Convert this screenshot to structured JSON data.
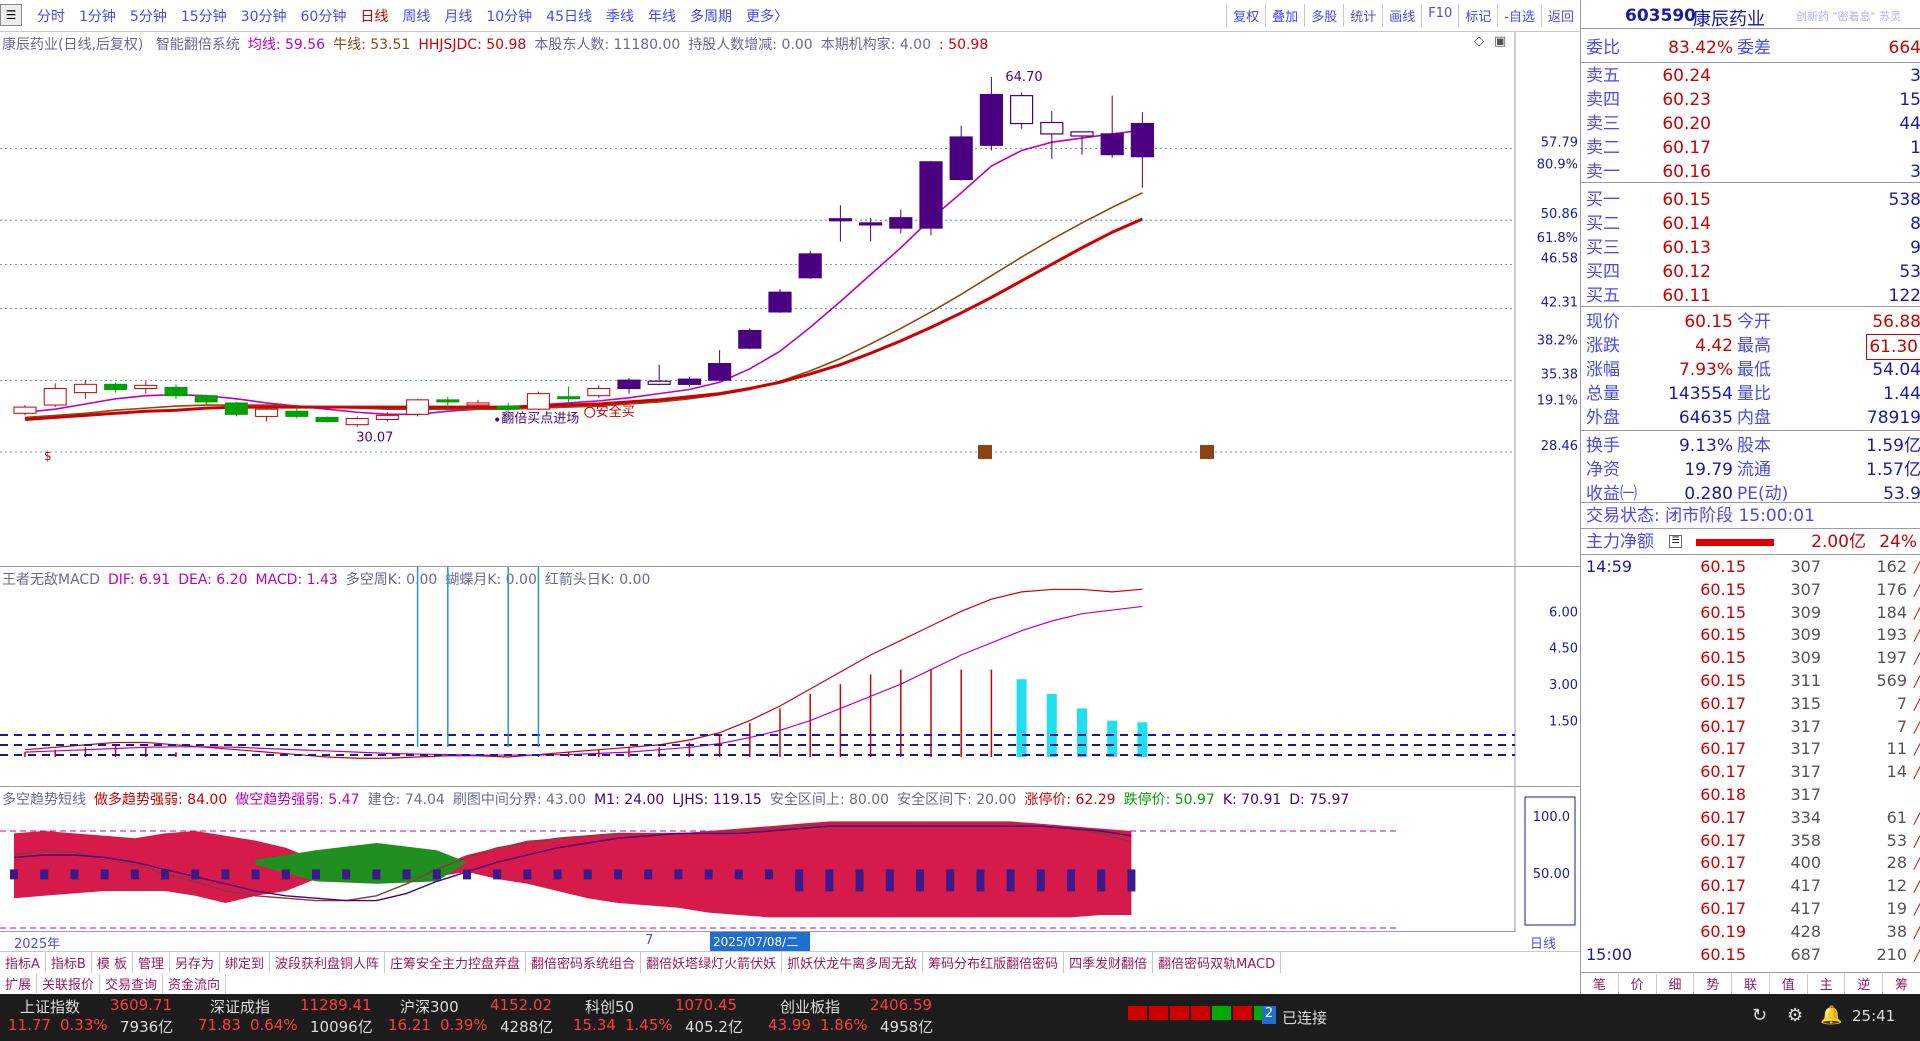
{
  "toolbar": {
    "periods": [
      "分时",
      "1分钟",
      "5分钟",
      "15分钟",
      "30分钟",
      "60分钟",
      "日线",
      "周线",
      "月线",
      "10分钟",
      "45日线",
      "季线",
      "年线",
      "多周期",
      "更多〉"
    ],
    "active_period": "日线",
    "tools": [
      "复权",
      "叠加",
      "多股",
      "统计",
      "画线",
      "F10",
      "标记",
      "-自选",
      "返回"
    ]
  },
  "main_chart": {
    "header": "康辰药业(日线,后复权)",
    "indicators": [
      {
        "label": "智能翻倍系统",
        "color": "#6a6a9a"
      },
      {
        "label": "均线: 59.56",
        "color": "#c000c0"
      },
      {
        "label": "牛线: 53.51",
        "color": "#8a4a10"
      },
      {
        "label": "HHJSJDC: 50.98",
        "color": "#d00000"
      },
      {
        "label": "本股东人数: 11180.00",
        "color": "#6a6a9a"
      },
      {
        "label": "持股人数增减: 0.00",
        "color": "#6a6a9a"
      },
      {
        "label": "本期机构家: 4.00",
        "color": "#6a6a9a"
      },
      {
        "label": ": 50.98",
        "color": "#d00000"
      }
    ],
    "price_labels": [
      "57.79",
      "50.86",
      "46.58",
      "42.31",
      "35.38",
      "28.46"
    ],
    "pct_labels": [
      "80.9%",
      "61.8%",
      "38.2%",
      "19.1%"
    ],
    "annotations": {
      "high": "64.70",
      "low": "30.07",
      "buy_signal": "翻倍买点进场",
      "safe_buy": "安全买"
    }
  },
  "macd_chart": {
    "header": [
      "王者无敌MACD",
      "DIF: 6.91",
      "DEA: 6.20",
      "MACD: 1.43",
      "多空周K: 0.00",
      "蝴蝶月K: 0.00",
      "红箭头日K: 0.00"
    ],
    "axis_labels": [
      "6.00",
      "4.50",
      "3.00",
      "1.50"
    ]
  },
  "ind_chart": {
    "header": [
      "多空趋势短线",
      "做多趋势强弱: 84.00",
      "做空趋势强弱: 5.47",
      "建仓: 74.04",
      "刷图中间分界: 43.00",
      "M1: 24.00",
      "LJHS: 119.15",
      "安全区间上: 80.00",
      "安全区间下: 20.00",
      "涨停价: 62.29",
      "跌停价: 50.97",
      "K: 70.91",
      "D: 75.97"
    ],
    "axis_labels": [
      "100.0",
      "50.00"
    ]
  },
  "datebar": {
    "year": "2025年",
    "mark": "7",
    "selected": "2025/07/08/二",
    "period": "日线"
  },
  "bottom_tabs": [
    "指标A",
    "指标B",
    "模 板",
    "管理",
    "另存为",
    "绑定到",
    "波段获利盘铜人阵",
    "庄筹安全主力控盘弃盘",
    "翻倍密码系统组合",
    "翻倍妖塔绿灯火箭伏妖",
    "抓妖伏龙牛离多周无敌",
    "筹码分布红版翻倍密码",
    "四季发财翻倍",
    "翻倍密码双轨MACD"
  ],
  "bottom_tabs2": [
    "扩展",
    "关联报价",
    "交易查询",
    "资金流向"
  ],
  "right_panel": {
    "code": "603590",
    "name": "康辰药业",
    "tag": "创新药 \"密着息\" 苏灵",
    "weibi": {
      "label": "委比",
      "value": "83.42%",
      "label2": "委差",
      "value2": "664"
    },
    "asks": [
      {
        "label": "卖五",
        "price": "60.24",
        "vol": "3"
      },
      {
        "label": "卖四",
        "price": "60.23",
        "vol": "15"
      },
      {
        "label": "卖三",
        "price": "60.20",
        "vol": "44"
      },
      {
        "label": "卖二",
        "price": "60.17",
        "vol": "1"
      },
      {
        "label": "卖一",
        "price": "60.16",
        "vol": "3"
      }
    ],
    "bids": [
      {
        "label": "买一",
        "price": "60.15",
        "vol": "538"
      },
      {
        "label": "买二",
        "price": "60.14",
        "vol": "8"
      },
      {
        "label": "买三",
        "price": "60.13",
        "vol": "9"
      },
      {
        "label": "买四",
        "price": "60.12",
        "vol": "53"
      },
      {
        "label": "买五",
        "price": "60.11",
        "vol": "122"
      }
    ],
    "quote": [
      {
        "l1": "现价",
        "v1": "60.15",
        "l2": "今开",
        "v2": "56.88"
      },
      {
        "l1": "涨跌",
        "v1": "4.42",
        "l2": "最高",
        "v2": "61.30"
      },
      {
        "l1": "涨幅",
        "v1": "7.93%",
        "l2": "最低",
        "v2": "54.04"
      },
      {
        "l1": "总量",
        "v1": "143554",
        "l2": "量比",
        "v2": "1.44"
      },
      {
        "l1": "外盘",
        "v1": "64635",
        "l2": "内盘",
        "v2": "78919"
      }
    ],
    "fundamentals": [
      {
        "l1": "换手",
        "v1": "9.13%",
        "l2": "股本",
        "v2": "1.59亿"
      },
      {
        "l1": "净资",
        "v1": "19.79",
        "l2": "流通",
        "v2": "1.57亿"
      },
      {
        "l1": "收益㈠",
        "v1": "0.280",
        "l2": "PE(动)",
        "v2": "53.9"
      }
    ],
    "trade_status": "交易状态: 闭市阶段 15:00:01",
    "main_net": {
      "label": "主力净额",
      "value": "2.00亿",
      "pct": "24%"
    },
    "ticks": [
      {
        "t": "14:59",
        "p": "60.15",
        "n": "307",
        "v": "162"
      },
      {
        "t": "",
        "p": "60.15",
        "n": "307",
        "v": "176"
      },
      {
        "t": "",
        "p": "60.15",
        "n": "309",
        "v": "184"
      },
      {
        "t": "",
        "p": "60.15",
        "n": "309",
        "v": "193"
      },
      {
        "t": "",
        "p": "60.15",
        "n": "309",
        "v": "197"
      },
      {
        "t": "",
        "p": "60.15",
        "n": "311",
        "v": "569"
      },
      {
        "t": "",
        "p": "60.17",
        "n": "315",
        "v": "7"
      },
      {
        "t": "",
        "p": "60.17",
        "n": "317",
        "v": "7"
      },
      {
        "t": "",
        "p": "60.17",
        "n": "317",
        "v": "11"
      },
      {
        "t": "",
        "p": "60.17",
        "n": "317",
        "v": "14"
      },
      {
        "t": "",
        "p": "60.18",
        "n": "317",
        "v": ""
      },
      {
        "t": "",
        "p": "60.17",
        "n": "334",
        "v": "61"
      },
      {
        "t": "",
        "p": "60.17",
        "n": "358",
        "v": "53"
      },
      {
        "t": "",
        "p": "60.17",
        "n": "400",
        "v": "28"
      },
      {
        "t": "",
        "p": "60.17",
        "n": "417",
        "v": "12"
      },
      {
        "t": "",
        "p": "60.17",
        "n": "417",
        "v": "19"
      },
      {
        "t": "",
        "p": "60.19",
        "n": "428",
        "v": "38"
      },
      {
        "t": "15:00",
        "p": "60.15",
        "n": "687",
        "v": "210"
      }
    ],
    "bottom_tabs": [
      "笔",
      "价",
      "细",
      "势",
      "联",
      "值",
      "主",
      "逆",
      "筹"
    ]
  },
  "status_bar": {
    "indices": [
      {
        "name": "上证指数",
        "value": "3609.71",
        "chg": "11.77",
        "pct": "0.33%",
        "amt": "7936亿"
      },
      {
        "name": "深证成指",
        "value": "11289.41",
        "chg": "71.83",
        "pct": "0.64%",
        "amt": "10096亿"
      },
      {
        "name": "沪深300",
        "value": "4152.02",
        "chg": "16.21",
        "pct": "0.39%",
        "amt": "4288亿"
      },
      {
        "name": "科创50",
        "value": "1070.45",
        "chg": "15.34",
        "pct": "1.45%",
        "amt": "405.2亿"
      },
      {
        "name": "创业板指",
        "value": "2406.59",
        "chg": "43.99",
        "pct": "1.86%",
        "amt": "4958亿"
      }
    ],
    "connection": "已连接",
    "connection_num": "2",
    "time": "25:41"
  },
  "chart_data": {
    "type": "candlestick",
    "title": "康辰药业(日线,后复权)",
    "ylim": [
      28.46,
      64.7
    ],
    "candles": [
      {
        "o": 32.2,
        "c": 32.8,
        "h": 33.0,
        "l": 32.0
      },
      {
        "o": 33.0,
        "c": 34.6,
        "h": 35.1,
        "l": 32.8
      },
      {
        "o": 34.2,
        "c": 35.0,
        "h": 35.4,
        "l": 33.6
      },
      {
        "o": 35.0,
        "c": 34.5,
        "h": 35.2,
        "l": 34.2
      },
      {
        "o": 34.6,
        "c": 34.9,
        "h": 35.3,
        "l": 34.1
      },
      {
        "o": 34.7,
        "c": 33.9,
        "h": 35.0,
        "l": 33.6
      },
      {
        "o": 33.9,
        "c": 33.3,
        "h": 34.0,
        "l": 33.0
      },
      {
        "o": 33.2,
        "c": 32.1,
        "h": 33.3,
        "l": 31.9
      },
      {
        "o": 31.9,
        "c": 32.6,
        "h": 32.7,
        "l": 31.4
      },
      {
        "o": 32.4,
        "c": 31.9,
        "h": 32.8,
        "l": 31.7
      },
      {
        "o": 31.8,
        "c": 31.4,
        "h": 31.9,
        "l": 31.3
      },
      {
        "o": 31.1,
        "c": 31.7,
        "h": 31.9,
        "l": 30.9
      },
      {
        "o": 31.6,
        "c": 32.0,
        "h": 32.3,
        "l": 31.4
      },
      {
        "o": 32.1,
        "c": 33.5,
        "h": 33.6,
        "l": 31.9
      },
      {
        "o": 33.5,
        "c": 33.3,
        "h": 33.8,
        "l": 32.6
      },
      {
        "o": 33.1,
        "c": 33.2,
        "h": 33.5,
        "l": 32.9
      },
      {
        "o": 32.9,
        "c": 32.6,
        "h": 33.2,
        "l": 31.7
      },
      {
        "o": 32.6,
        "c": 34.1,
        "h": 34.3,
        "l": 32.5
      },
      {
        "o": 33.8,
        "c": 33.7,
        "h": 34.8,
        "l": 33.0
      },
      {
        "o": 33.9,
        "c": 34.6,
        "h": 34.9,
        "l": 33.7
      },
      {
        "o": 34.6,
        "c": 35.4,
        "h": 35.6,
        "l": 34.1
      },
      {
        "o": 35.3,
        "c": 35.0,
        "h": 36.9,
        "l": 34.9
      },
      {
        "o": 35.0,
        "c": 35.5,
        "h": 35.7,
        "l": 34.8
      },
      {
        "o": 35.4,
        "c": 37.0,
        "h": 38.3,
        "l": 35.3
      },
      {
        "o": 38.5,
        "c": 40.2,
        "h": 40.4,
        "l": 38.4
      },
      {
        "o": 42.0,
        "c": 43.9,
        "h": 44.2,
        "l": 41.9
      },
      {
        "o": 45.3,
        "c": 47.6,
        "h": 47.9,
        "l": 45.2
      },
      {
        "o": 51.0,
        "c": 51.0,
        "h": 52.3,
        "l": 48.8
      },
      {
        "o": 50.6,
        "c": 50.6,
        "h": 51.1,
        "l": 48.8
      },
      {
        "o": 50.1,
        "c": 51.1,
        "h": 51.9,
        "l": 49.6
      },
      {
        "o": 50.1,
        "c": 56.5,
        "h": 56.6,
        "l": 49.4
      },
      {
        "o": 54.8,
        "c": 58.9,
        "h": 60.0,
        "l": 54.7
      },
      {
        "o": 58.1,
        "c": 63.0,
        "h": 64.7,
        "l": 57.6
      },
      {
        "o": 62.9,
        "c": 60.2,
        "h": 63.2,
        "l": 59.7
      },
      {
        "o": 60.3,
        "c": 59.2,
        "h": 61.4,
        "l": 56.8
      },
      {
        "o": 59.4,
        "c": 59.0,
        "h": 59.4,
        "l": 57.2
      },
      {
        "o": 57.2,
        "c": 59.2,
        "h": 62.9,
        "l": 56.9
      },
      {
        "o": 57.0,
        "c": 60.2,
        "h": 61.3,
        "l": 54.0
      }
    ],
    "series": [
      {
        "name": "均线",
        "color": "#c000c0",
        "values": [
          32.3,
          32.6,
          33.1,
          33.6,
          33.9,
          34.0,
          33.9,
          33.6,
          33.2,
          32.9,
          32.6,
          32.3,
          32.1,
          32.1,
          32.4,
          32.6,
          32.7,
          33.0,
          33.2,
          33.4,
          33.7,
          34.1,
          34.5,
          35.2,
          36.5,
          38.2,
          40.5,
          43.0,
          45.6,
          48.2,
          51.0,
          53.5,
          56.1,
          57.6,
          58.4,
          58.8,
          59.2,
          59.56
        ]
      },
      {
        "name": "牛线",
        "color": "#8a4a10",
        "values": [
          31.8,
          32.0,
          32.2,
          32.5,
          32.7,
          32.9,
          33.0,
          33.0,
          33.0,
          32.9,
          32.8,
          32.7,
          32.6,
          32.6,
          32.6,
          32.6,
          32.6,
          32.7,
          32.8,
          32.9,
          33.1,
          33.3,
          33.6,
          34.0,
          34.5,
          35.3,
          36.3,
          37.5,
          38.9,
          40.4,
          42.0,
          43.7,
          45.5,
          47.3,
          49.0,
          50.6,
          52.1,
          53.51
        ]
      },
      {
        "name": "HHJSJDC",
        "color": "#d00000",
        "values": [
          31.6,
          31.8,
          32.0,
          32.2,
          32.4,
          32.5,
          32.7,
          32.8,
          32.8,
          32.8,
          32.8,
          32.8,
          32.8,
          32.8,
          32.8,
          32.8,
          32.8,
          32.9,
          33.0,
          33.1,
          33.3,
          33.5,
          33.8,
          34.1,
          34.6,
          35.2,
          36.0,
          36.9,
          38.0,
          39.2,
          40.5,
          41.9,
          43.4,
          45.0,
          46.6,
          48.2,
          49.7,
          50.98
        ]
      }
    ]
  }
}
